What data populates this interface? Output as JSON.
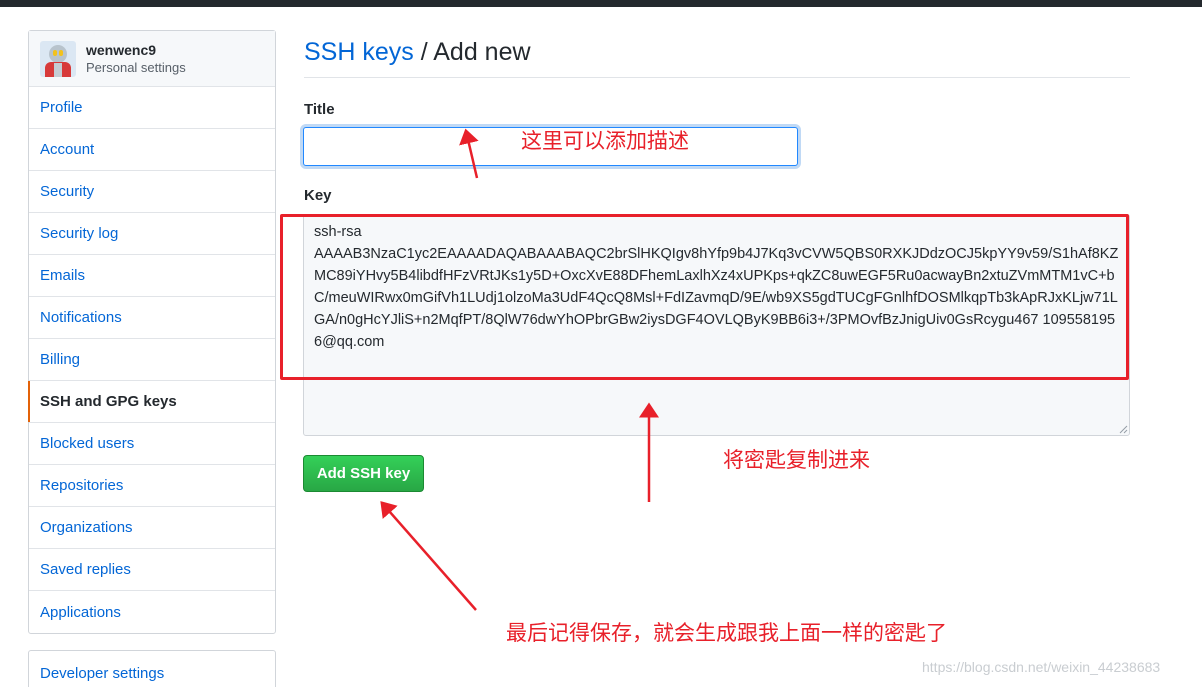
{
  "user": {
    "name": "wenwenc9",
    "subtitle": "Personal settings"
  },
  "sidebar": {
    "items": [
      {
        "label": "Profile"
      },
      {
        "label": "Account"
      },
      {
        "label": "Security"
      },
      {
        "label": "Security log"
      },
      {
        "label": "Emails"
      },
      {
        "label": "Notifications"
      },
      {
        "label": "Billing"
      },
      {
        "label": "SSH and GPG keys",
        "selected": true
      },
      {
        "label": "Blocked users"
      },
      {
        "label": "Repositories"
      },
      {
        "label": "Organizations"
      },
      {
        "label": "Saved replies"
      },
      {
        "label": "Applications"
      }
    ],
    "developer_settings": "Developer settings"
  },
  "header": {
    "crumb": "SSH keys",
    "separator": " / ",
    "title": "Add new"
  },
  "form": {
    "title_label": "Title",
    "title_value": "",
    "key_label": "Key",
    "key_value": "ssh-rsa\nAAAAB3NzaC1yc2EAAAADAQABAAABAQC2brSlHKQIgv8hYfp9b4J7Kq3vCVW5QBS0RXKJDdzOCJ5kpYY9v59/S1hAf8KZMC89iYHvy5B4libdfHFzVRtJKs1y5D+OxcXvE88DFhemLaxlhXz4xUPKps+qkZC8uwEGF5Ru0acwayBn2xtuZVmMTM1vC+bC/meuWIRwx0mGifVh1LUdj1olzoMa3UdF4QcQ8Msl+FdIZavmqD/9E/wb9XS5gdTUCgFGnlhfDOSMlkqpTb3kApRJxKLjw71LGA/n0gHcYJliS+n2MqfPT/8QlW76dwYhOPbrGBw2iysDGF4OVLQByK9BB6i3+/3PMOvfBzJnigUiv0GsRcygu467 1095581956@qq.com",
    "submit_label": "Add SSH key"
  },
  "annotations": {
    "title_note": "这里可以添加描述",
    "key_note": "将密匙复制进来",
    "save_note": "最后记得保存，就会生成跟我上面一样的密匙了",
    "color": "#e8202a"
  },
  "watermark": "https://blog.csdn.net/weixin_44238683",
  "colors": {
    "link": "#0366d6",
    "button": "#28a745",
    "selected_marker": "#e36209"
  }
}
